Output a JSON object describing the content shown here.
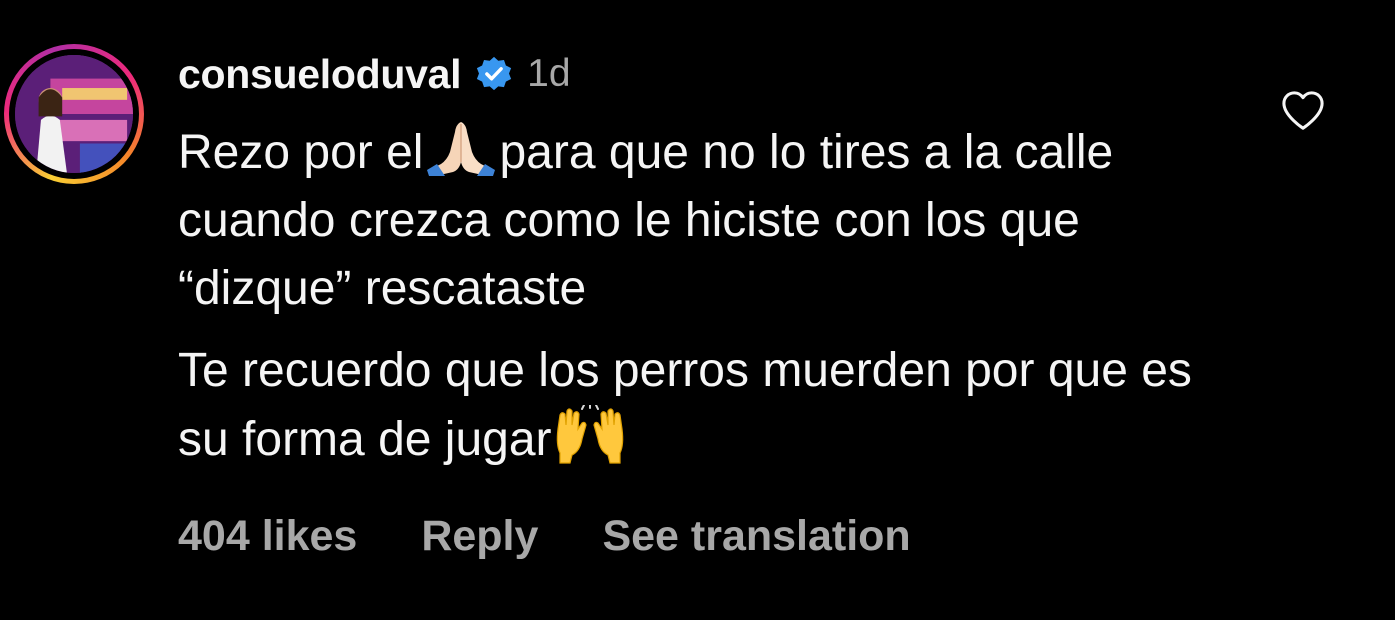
{
  "comment": {
    "username": "consueloduval",
    "verified_icon": "verified-badge-icon",
    "timestamp": "1d",
    "paragraph1": {
      "part1": "Rezo por el",
      "emoji1": "folded-hands-emoji",
      "part2": "para que no lo tires a la calle cuando crezca como le hiciste con los que “dizque” rescataste"
    },
    "paragraph2": {
      "part1": "Te recuerdo que los perros muerden por que es su forma de jugar",
      "emoji2": "raising-hands-emoji"
    },
    "likes": "404 likes",
    "reply_label": "Reply",
    "translation_label": "See translation",
    "like_icon": "heart-icon"
  },
  "colors": {
    "background": "#000000",
    "primary_text": "#f5f5f5",
    "secondary_text": "#a8a8a8",
    "verified_blue": "#3897f0"
  }
}
